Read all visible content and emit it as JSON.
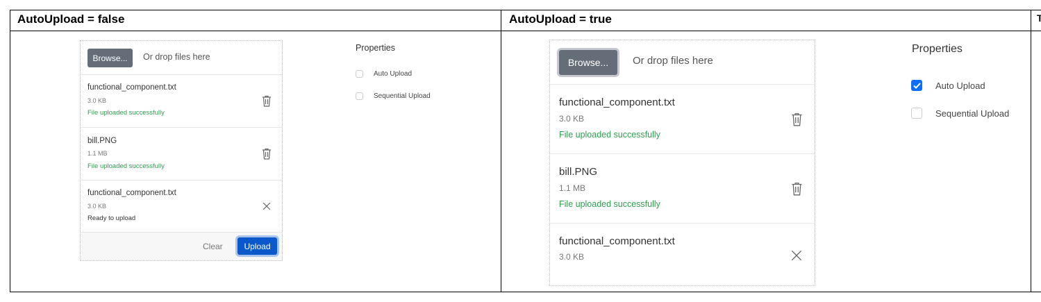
{
  "headers": {
    "left": "AutoUpload = false",
    "right": "AutoUpload = true",
    "cut": "T"
  },
  "left": {
    "browse_label": "Browse...",
    "drop_hint": "Or drop files here",
    "files": [
      {
        "name": "functional_component.txt",
        "size": "3.0 KB",
        "status": "File uploaded successfully",
        "action_icon": "trash-icon"
      },
      {
        "name": "bill.PNG",
        "size": "1.1 MB",
        "status": "File uploaded successfully",
        "action_icon": "trash-icon"
      },
      {
        "name": "functional_component.txt",
        "size": "3.0 KB",
        "status": "Ready to upload",
        "action_icon": "close-icon"
      }
    ],
    "clear_label": "Clear",
    "upload_label": "Upload",
    "properties": {
      "title": "Properties",
      "auto_upload": {
        "label": "Auto Upload",
        "checked": false
      },
      "sequential_upload": {
        "label": "Sequential Upload",
        "checked": false
      }
    }
  },
  "right": {
    "browse_label": "Browse...",
    "drop_hint": "Or drop files here",
    "files": [
      {
        "name": "functional_component.txt",
        "size": "3.0 KB",
        "status": "File uploaded successfully",
        "action_icon": "trash-icon"
      },
      {
        "name": "bill.PNG",
        "size": "1.1 MB",
        "status": "File uploaded successfully",
        "action_icon": "trash-icon"
      },
      {
        "name": "functional_component.txt",
        "size": "3.0 KB",
        "status": "",
        "action_icon": "close-icon"
      }
    ],
    "properties": {
      "title": "Properties",
      "auto_upload": {
        "label": "Auto Upload",
        "checked": true
      },
      "sequential_upload": {
        "label": "Sequential Upload",
        "checked": false
      }
    }
  },
  "colors": {
    "browse_bg": "#656d78",
    "upload_bg": "#0a58ca",
    "success_text": "#2e9e4f",
    "checkbox_checked": "#0d6efd"
  }
}
